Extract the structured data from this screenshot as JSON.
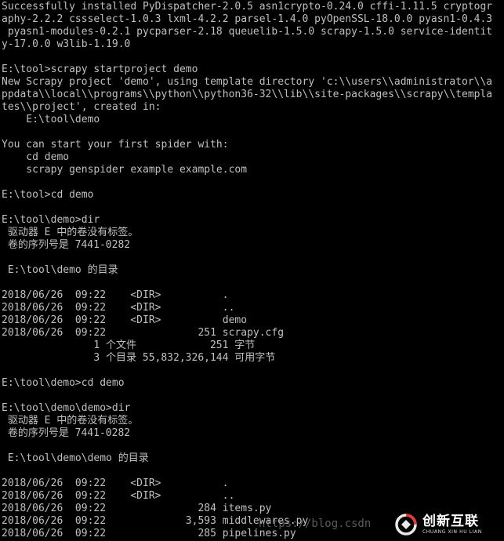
{
  "console": {
    "lines": [
      "Successfully installed PyDispatcher-2.0.5 asn1crypto-0.24.0 cffi-1.11.5 cryptogr",
      "aphy-2.2.2 cssselect-1.0.3 lxml-4.2.2 parsel-1.4.0 pyOpenSSL-18.0.0 pyasn1-0.4.3",
      " pyasn1-modules-0.2.1 pycparser-2.18 queuelib-1.5.0 scrapy-1.5.0 service-identit",
      "y-17.0.0 w3lib-1.19.0",
      "",
      "E:\\tool>scrapy startproject demo",
      "New Scrapy project 'demo', using template directory 'c:\\\\users\\\\administrator\\\\a",
      "ppdata\\\\local\\\\programs\\\\python\\\\python36-32\\\\lib\\\\site-packages\\\\scrapy\\\\templa",
      "tes\\\\project', created in:",
      "    E:\\tool\\demo",
      "",
      "You can start your first spider with:",
      "    cd demo",
      "    scrapy genspider example example.com",
      "",
      "E:\\tool>cd demo",
      "",
      "E:\\tool\\demo>dir",
      " 驱动器 E 中的卷没有标签。",
      " 卷的序列号是 7441-0282",
      "",
      " E:\\tool\\demo 的目录",
      "",
      "2018/06/26  09:22    <DIR>          .",
      "2018/06/26  09:22    <DIR>          ..",
      "2018/06/26  09:22    <DIR>          demo",
      "2018/06/26  09:22               251 scrapy.cfg",
      "               1 个文件            251 字节",
      "               3 个目录 55,832,326,144 可用字节",
      "",
      "E:\\tool\\demo>cd demo",
      "",
      "E:\\tool\\demo\\demo>dir",
      " 驱动器 E 中的卷没有标签。",
      " 卷的序列号是 7441-0282",
      "",
      " E:\\tool\\demo\\demo 的目录",
      "",
      "2018/06/26  09:22    <DIR>          .",
      "2018/06/26  09:22    <DIR>          ..",
      "2018/06/26  09:22               284 items.py",
      "2018/06/26  09:22             3,593 middlewares.py",
      "2018/06/26  09:22               285 pipelines.py"
    ]
  },
  "watermark": {
    "text": "https://blog.csdn"
  },
  "logo": {
    "name": "创新互联",
    "subtitle": "CHUANG XIN HU LIAN",
    "colors": {
      "ring": "#e8e8e8",
      "accent": "#e53935"
    }
  }
}
